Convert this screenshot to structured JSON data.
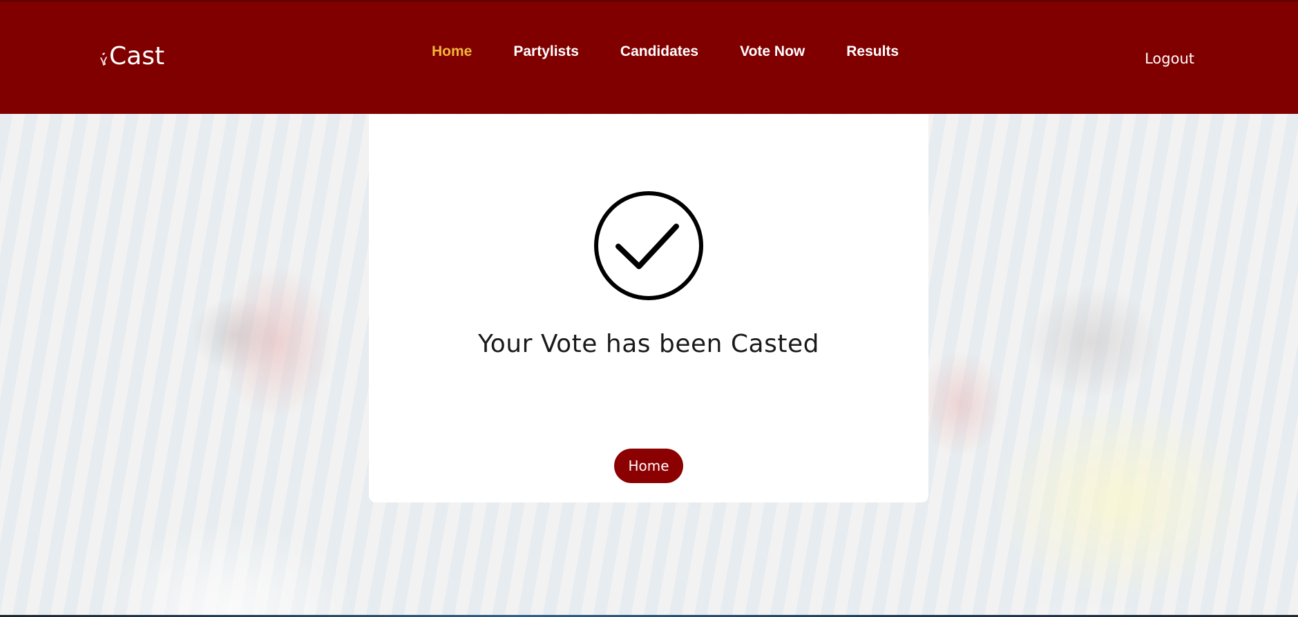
{
  "navbar": {
    "brand": "Cast",
    "links": [
      {
        "label": "Home",
        "active": true
      },
      {
        "label": "Partylists",
        "active": false
      },
      {
        "label": "Candidates",
        "active": false
      },
      {
        "label": "Vote Now",
        "active": false
      },
      {
        "label": "Results",
        "active": false
      }
    ],
    "logout_label": "Logout"
  },
  "confirmation": {
    "icon": "check-circle-icon",
    "message": "Your Vote has been Casted",
    "home_button_label": "Home"
  },
  "colors": {
    "header_bg": "#800000",
    "active_link": "#f2b63c",
    "button_bg": "#8b0000"
  }
}
